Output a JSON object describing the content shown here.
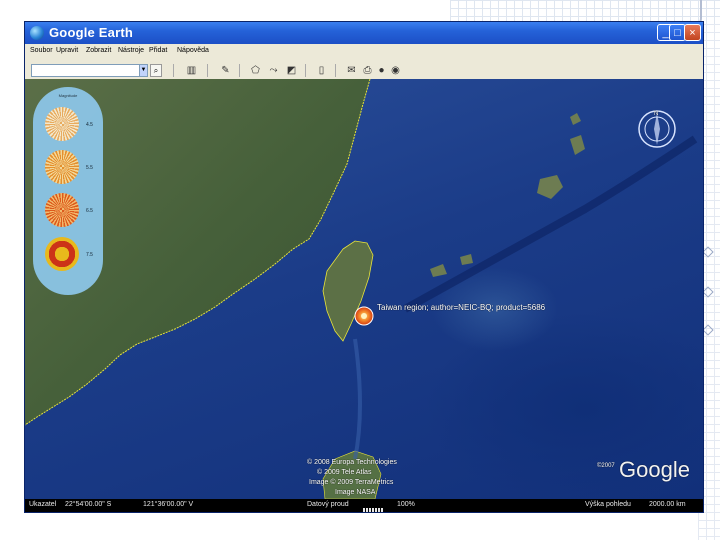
{
  "window": {
    "title": "Google Earth",
    "controls": [
      "_",
      "□",
      "×"
    ]
  },
  "menu": [
    "Soubor",
    "Upravit",
    "Zobrazit",
    "Nástroje",
    "Přidat",
    "Nápověda"
  ],
  "toolbar": {
    "search_value": "",
    "search_icon": "magnifier-icon",
    "icons": [
      "sidebar-toggle-icon",
      "placemark-icon",
      "polygon-icon",
      "path-icon",
      "image-overlay-icon",
      "record-tour-icon",
      "ruler-icon",
      "email-icon",
      "print-icon",
      "google-maps-icon"
    ]
  },
  "map": {
    "placemark_label": "Taiwan region; author=NEIC-BQ; product=5686",
    "legend": {
      "title": "Magnitude",
      "values": [
        "4.5",
        "5.5",
        "6.5",
        "7.5"
      ]
    },
    "compass_north": "N",
    "attribution": [
      "© 2008 Europa Technologies",
      "© 2009 Tele Atlas",
      "Image © 2009 TerraMetrics",
      "Image NASA"
    ],
    "logo_text": "Google",
    "logo_year": "©2007"
  },
  "status": {
    "pointer_label": "Ukazatel",
    "lat": "22°54'00.00\" S",
    "lon": "121°36'00.00\" V",
    "stream_label": "Datový proud",
    "stream_percent": "100%",
    "eye_alt_label": "Výška pohledu",
    "eye_alt": "2000.00 km",
    "stream_progress": 1.0
  },
  "colors": {
    "ocean": "#1b3c88",
    "land": "#46603a",
    "legend_bg": "#8dc7ea",
    "quake_marker": "#f06a1e"
  }
}
